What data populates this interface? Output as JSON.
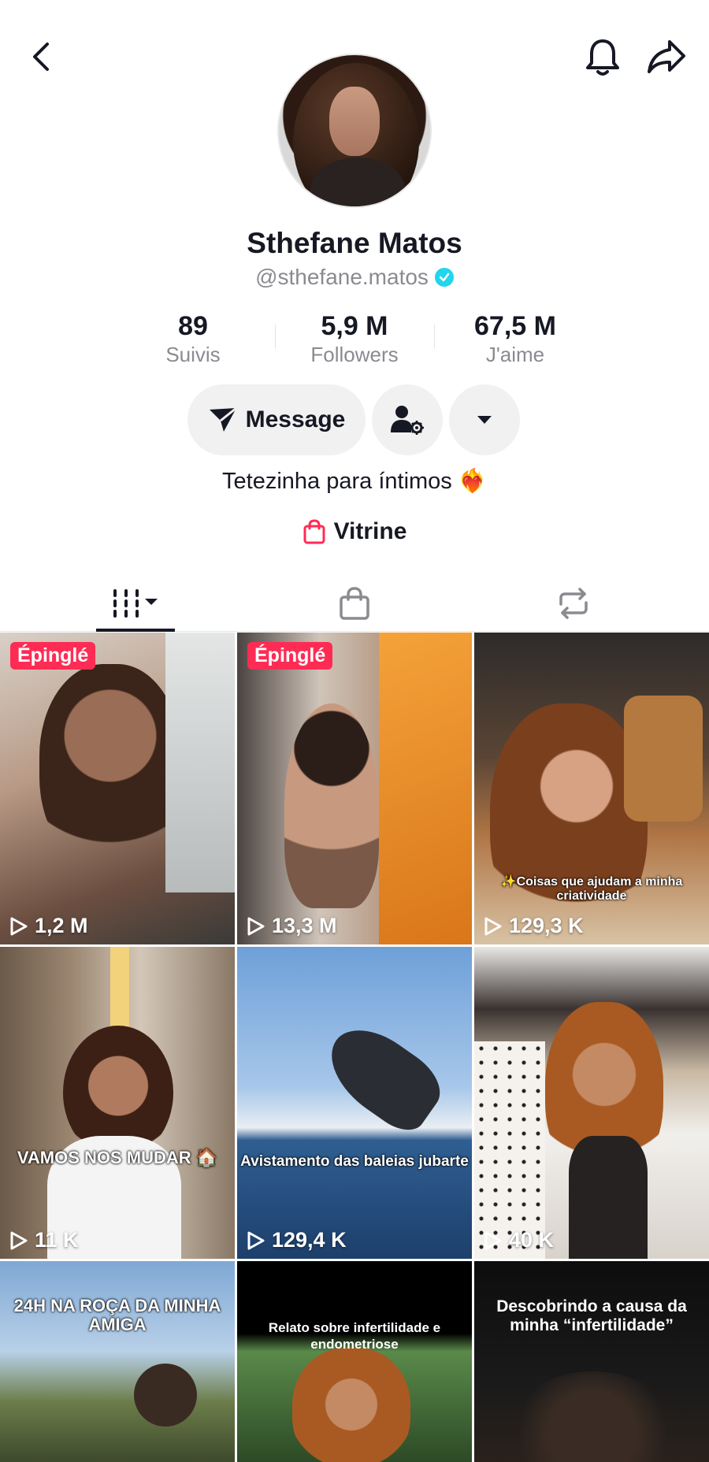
{
  "profile": {
    "name": "Sthefane Matos",
    "handle": "@sthefane.matos",
    "bio": "Tetezinha para íntimos ❤️‍🔥"
  },
  "stats": [
    {
      "value": "89",
      "label": "Suivis"
    },
    {
      "value": "5,9 M",
      "label": "Followers"
    },
    {
      "value": "67,5 M",
      "label": "J'aime"
    }
  ],
  "actions": {
    "message_label": "Message"
  },
  "showcase": {
    "label": "Vitrine"
  },
  "tabs": [
    {
      "icon": "videos-grid-icon",
      "active": true
    },
    {
      "icon": "shopping-bag-icon",
      "active": false
    },
    {
      "icon": "repost-icon",
      "active": false
    }
  ],
  "videos": [
    {
      "pinned": "Épinglé",
      "views": "1,2 M",
      "caption": ""
    },
    {
      "pinned": "Épinglé",
      "views": "13,3 M",
      "caption": ""
    },
    {
      "pinned": "",
      "views": "129,3 K",
      "caption": "✨Coisas que ajudam a minha criatividade"
    },
    {
      "pinned": "",
      "views": "11 K",
      "caption": "VAMOS NOS MUDAR 🏠"
    },
    {
      "pinned": "",
      "views": "129,4 K",
      "caption": "Avistamento das baleias jubarte"
    },
    {
      "pinned": "",
      "views": "40 K",
      "caption": ""
    },
    {
      "pinned": "",
      "views": "",
      "caption": "24H NA ROÇA DA MINHA AMIGA"
    },
    {
      "pinned": "",
      "views": "",
      "caption": "Relato sobre infertilidade e endometriose"
    },
    {
      "pinned": "",
      "views": "",
      "caption": "Descobrindo a causa da minha “infertilidade”"
    }
  ],
  "colors": {
    "accent": "#fe2c55",
    "verified": "#20d5ec",
    "text_primary": "#161823",
    "text_secondary": "#8a8b91"
  }
}
